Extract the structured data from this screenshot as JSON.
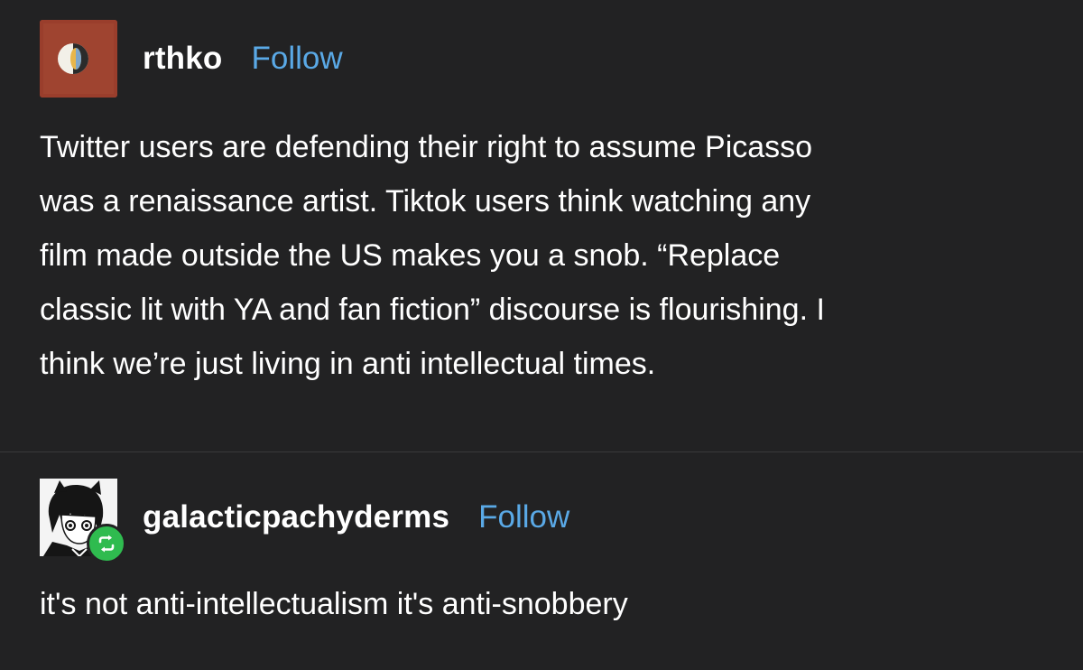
{
  "posts": [
    {
      "username": "rthko",
      "follow_label": "Follow",
      "avatar_icon": "abstract-circle-painting-avatar",
      "body_lines": [
        "Twitter users are defending their right to assume Picasso",
        "was a renaissance artist. Tiktok users think watching any",
        "film made outside the US makes you a snob. “Replace",
        "classic lit with YA and fan fiction” discourse is flourishing. I",
        "think we’re just living in anti intellectual times."
      ]
    },
    {
      "username": "galacticpachyderms",
      "follow_label": "Follow",
      "avatar_icon": "manga-character-avatar",
      "badge_icon": "reblog-icon",
      "body": "it's not anti-intellectualism it's anti-snobbery"
    }
  ],
  "colors": {
    "background": "#222223",
    "link": "#5aa9e6",
    "reblog_badge": "#2fbb4f",
    "avatar_1_bg": "#9a3e2c"
  }
}
